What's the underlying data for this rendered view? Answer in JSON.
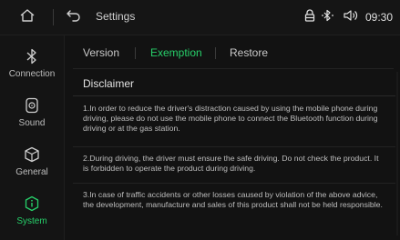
{
  "header": {
    "title": "Settings",
    "time": "09:30",
    "icons": [
      "home-icon",
      "back-icon",
      "battery-lock-icon",
      "bluetooth-icon",
      "volume-icon"
    ]
  },
  "sidebar": {
    "items": [
      {
        "label": "Connection",
        "icon": "bluetooth-icon",
        "active": false
      },
      {
        "label": "Sound",
        "icon": "sound-icon",
        "active": false
      },
      {
        "label": "General",
        "icon": "cube-icon",
        "active": false
      },
      {
        "label": "System",
        "icon": "info-icon",
        "active": true
      }
    ]
  },
  "tabs": [
    {
      "label": "Version",
      "active": false
    },
    {
      "label": "Exemption",
      "active": true
    },
    {
      "label": "Restore",
      "active": false
    }
  ],
  "content": {
    "heading": "Disclaimer",
    "paragraphs": [
      "1.In order to reduce the driver's distraction caused by using the mobile phone during driving, please do not use the mobile phone to connect the Bluetooth function during driving or at the gas station.",
      "2.During driving, the driver must ensure the safe driving. Do not check the product. It is forbidden to operate the product during driving.",
      "3.In case of traffic accidents or other losses caused by violation of the above advice, the development, manufacture and sales of this product shall not be held responsible."
    ]
  },
  "colors": {
    "accent": "#27d06a",
    "background": "#111111",
    "text": "#d0d0d0"
  }
}
